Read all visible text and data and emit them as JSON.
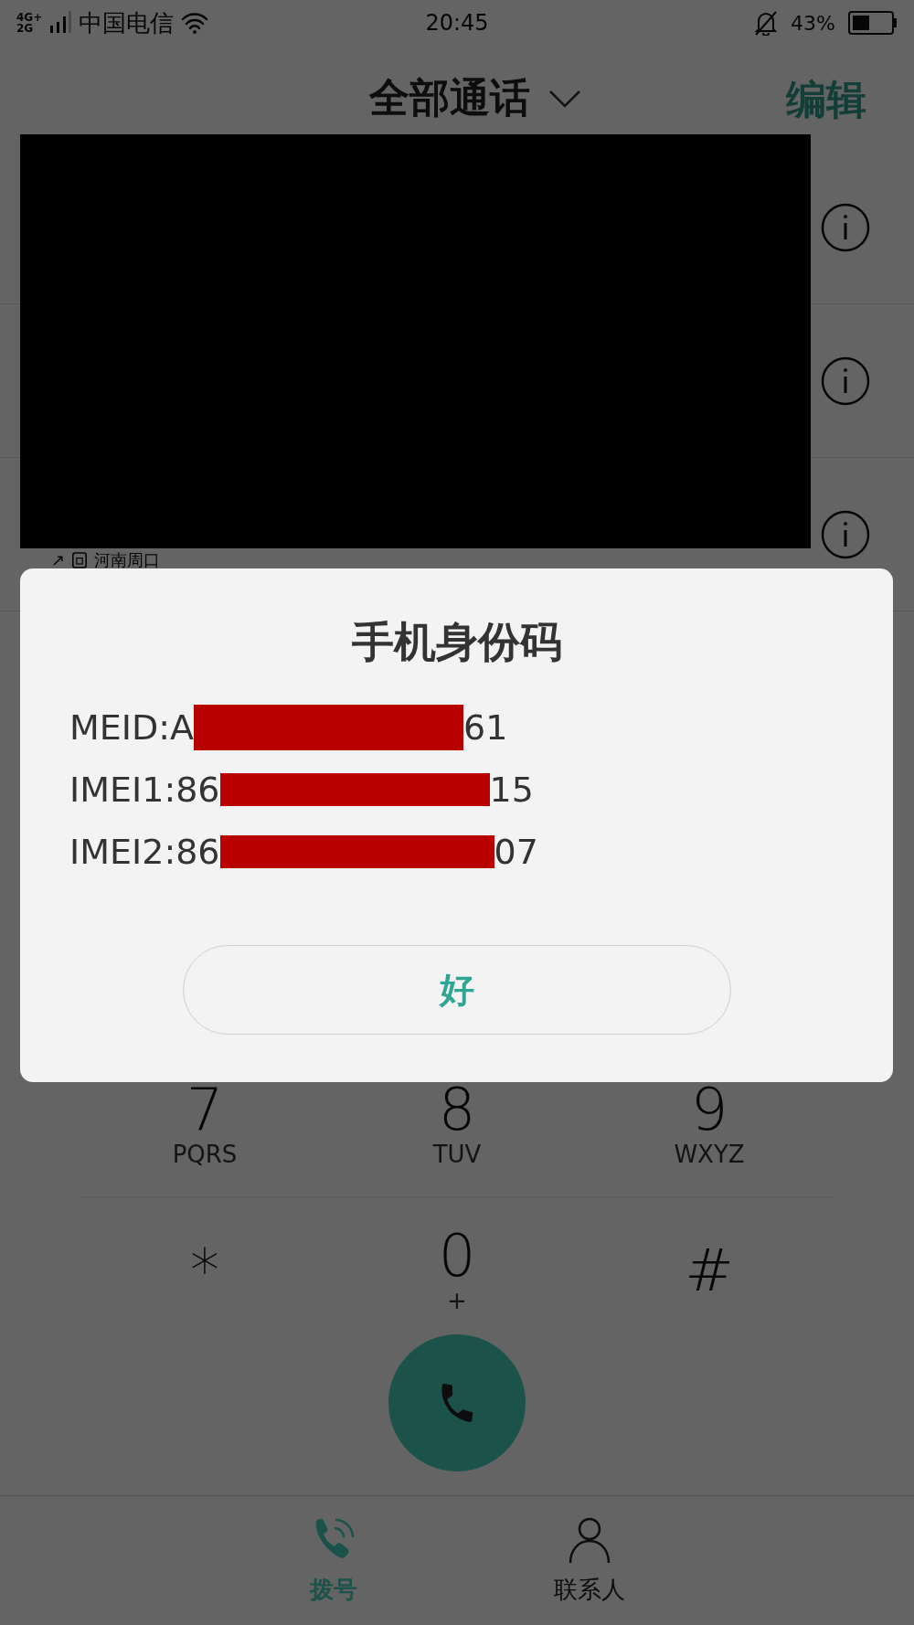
{
  "status_bar": {
    "network": [
      "4G+",
      "2G"
    ],
    "carrier": "中国电信",
    "time": "20:45",
    "battery": "43%"
  },
  "header": {
    "title": "全部通话",
    "action": "编辑"
  },
  "call_list": {
    "caption_icon": "↗",
    "caption": "河南周口"
  },
  "keypad": [
    {
      "digit": "7",
      "letters": "PQRS"
    },
    {
      "digit": "8",
      "letters": "TUV"
    },
    {
      "digit": "9",
      "letters": "WXYZ"
    },
    {
      "digit": "*"
    },
    {
      "digit": "0",
      "letters": "+"
    },
    {
      "digit": "#"
    }
  ],
  "tabs": [
    {
      "label": "拨号",
      "selected": true
    },
    {
      "label": "联系人",
      "selected": false
    }
  ],
  "dialog": {
    "title": "手机身份码",
    "lines": [
      {
        "prefix": "MEID:A",
        "suffix": "61"
      },
      {
        "prefix": "IMEI1:86",
        "suffix": "15"
      },
      {
        "prefix": "IMEI2:86",
        "suffix": "07"
      }
    ],
    "button": "好"
  }
}
